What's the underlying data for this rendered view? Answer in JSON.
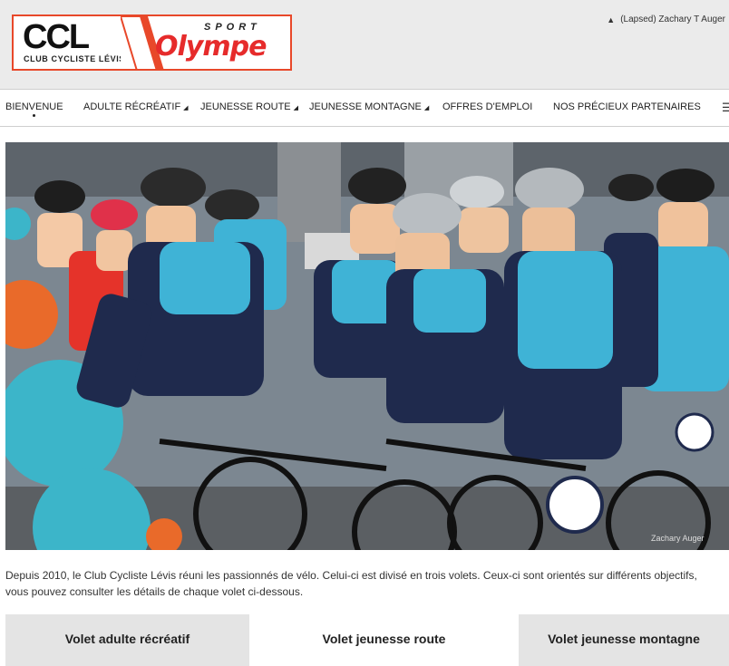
{
  "header": {
    "logo": {
      "ccl_text": "CCL",
      "club_name": "CLUB CYCLISTE LÉVIS",
      "sponsor_top": "SPORT",
      "sponsor_main": "Olympe"
    },
    "user_label": "(Lapsed) Zachary T Auger"
  },
  "nav": {
    "items": [
      {
        "label": "BIENVENUE"
      },
      {
        "label": "ADULTE RÉCRÉATIF"
      },
      {
        "label": "JEUNESSE ROUTE"
      },
      {
        "label": "JEUNESSE MONTAGNE"
      },
      {
        "label": "OFFRES D'EMPLOI"
      },
      {
        "label": "NOS PRÉCIEUX PARTENAIRES"
      }
    ],
    "menu_icon": "hamburger-icon"
  },
  "hero": {
    "photo_credit": "Zachary Auger"
  },
  "intro": {
    "text": "Depuis 2010, le Club Cycliste Lévis réuni les passionnés de vélo. Celui-ci est divisé en trois volets. Ceux-ci sont orientés sur différents objectifs, vous pouvez consulter les détails de chaque volet ci-dessous."
  },
  "tabs": [
    {
      "label": "Volet adulte récréatif"
    },
    {
      "label": "Volet jeunesse route"
    },
    {
      "label": "Volet jeunesse montagne"
    }
  ],
  "colors": {
    "brand_orange": "#e8482a",
    "brand_red": "#e62b2b",
    "header_bg": "#ebebeb",
    "tab_grey": "#e4e4e4",
    "jersey_cyan": "#3fb3d6",
    "jersey_navy": "#1f2a4d"
  }
}
